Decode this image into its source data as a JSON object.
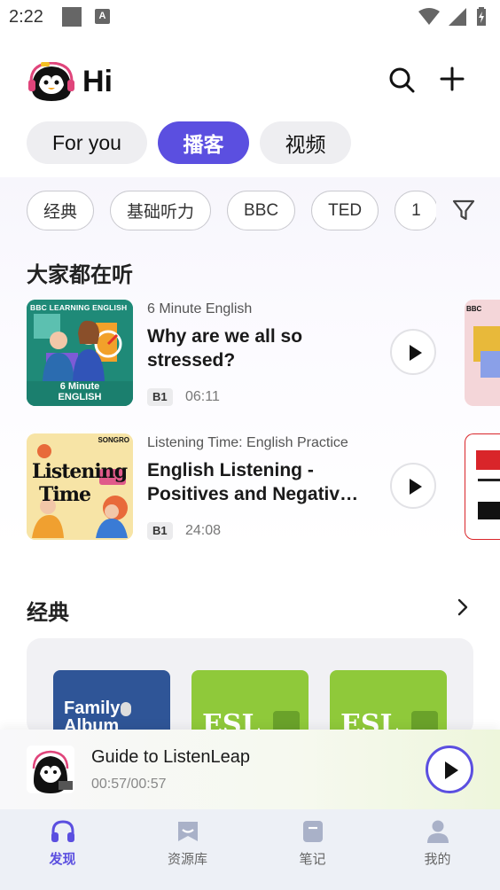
{
  "status_bar": {
    "time": "2:22",
    "badge_letter": "A"
  },
  "header": {
    "greeting": "Hi"
  },
  "top_tabs": [
    {
      "label": "For you",
      "active": false
    },
    {
      "label": "播客",
      "active": true
    },
    {
      "label": "视频",
      "active": false
    }
  ],
  "filter_chips": [
    "经典",
    "基础听力",
    "BBC",
    "TED",
    "1"
  ],
  "sections": {
    "popular": "大家都在听",
    "classic": "经典"
  },
  "podcasts": [
    {
      "show": "6 Minute English",
      "title": "Why are we all so stressed?",
      "level": "B1",
      "duration": "06:11",
      "thumb_brand": "BBC LEARNING ENGLISH",
      "thumb_caption_1": "6 Minute",
      "thumb_caption_2": "ENGLISH"
    },
    {
      "show": "Listening Time: English Practice",
      "title": "English Listening - Positives and Negativ…",
      "level": "B1",
      "duration": "24:08",
      "thumb_top": "SONGRO",
      "thumb_word_1": "Listening",
      "thumb_word_2": "Time"
    }
  ],
  "classic_books": [
    {
      "text_1": "Family",
      "text_2": "Album"
    },
    {
      "text_1": "ESL"
    },
    {
      "text_1": "ESL"
    }
  ],
  "mini_player": {
    "title": "Guide to ListenLeap",
    "time": "00:57/00:57"
  },
  "bottom_nav": [
    {
      "label": "发现",
      "icon": "headphones-icon",
      "active": true
    },
    {
      "label": "资源库",
      "icon": "bookmark-icon",
      "active": false
    },
    {
      "label": "笔记",
      "icon": "note-icon",
      "active": false
    },
    {
      "label": "我的",
      "icon": "person-icon",
      "active": false
    }
  ],
  "colors": {
    "accent": "#5b4fe0",
    "bbc_green": "#1f8a78",
    "esl_green": "#8fc93a"
  }
}
